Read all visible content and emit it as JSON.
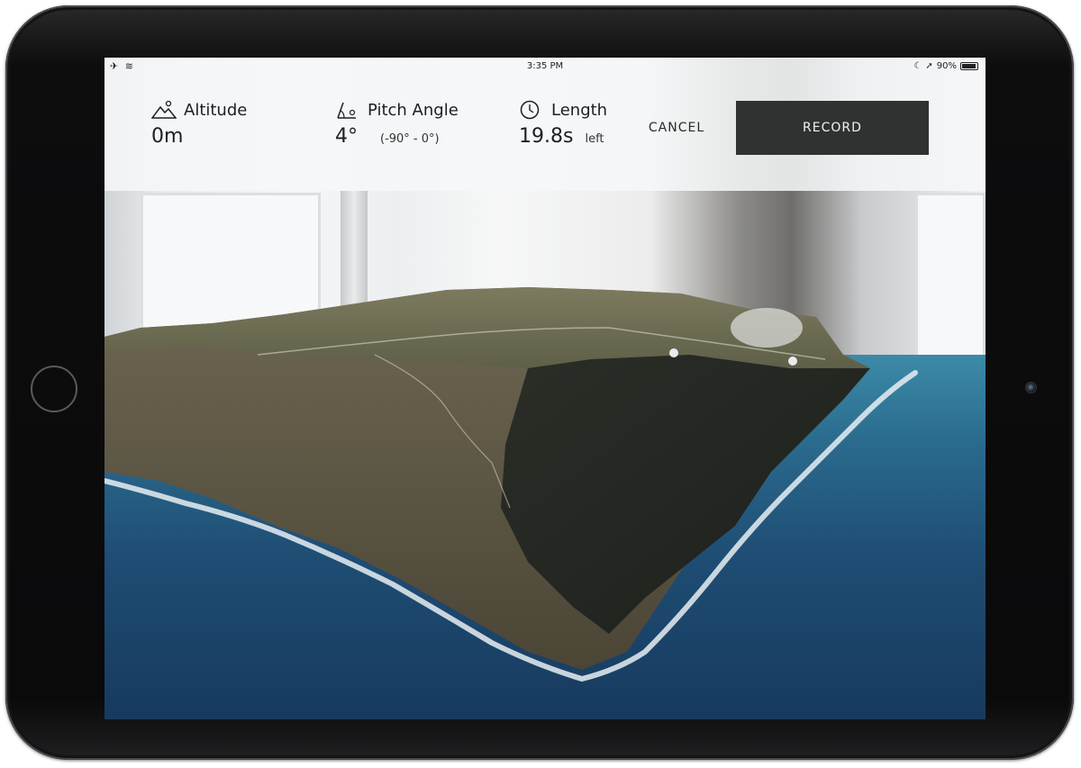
{
  "status_bar": {
    "left_icons": [
      "airplane-mode-icon",
      "wifi-icon"
    ],
    "time": "3:35 PM",
    "battery_percent": "90%"
  },
  "header": {
    "altitude": {
      "icon": "mountain-icon",
      "label": "Altitude",
      "value": "0m"
    },
    "pitch": {
      "icon": "pitch-angle-icon",
      "label": "Pitch Angle",
      "value": "4°",
      "range": "(-90° - 0°)"
    },
    "length": {
      "icon": "clock-icon",
      "label": "Length",
      "value": "19.8s",
      "suffix": "left"
    },
    "cancel_label": "CANCEL",
    "record_label": "RECORD"
  },
  "colors": {
    "header_bg": "#f6f7f8",
    "record_bg": "#303131",
    "ocean": "#1f4d74",
    "terrain": "#6f6a55"
  }
}
